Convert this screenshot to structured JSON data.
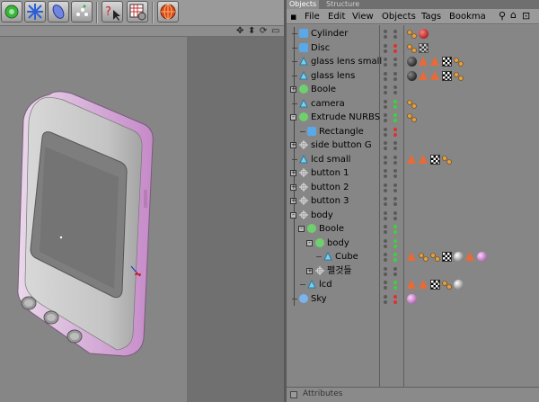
{
  "viewport": {
    "toolbar_icons": [
      "generator-icon",
      "deformer-icon",
      "spline-icon",
      "particle-icon",
      "help-pointer-icon",
      "render-settings-icon",
      "render-view-icon"
    ],
    "nav_icons": [
      "move-view-icon",
      "dolly-view-icon",
      "rotate-view-icon",
      "maximize-view-icon"
    ]
  },
  "om": {
    "tabs": [
      "Objects",
      "Structure"
    ],
    "menu": [
      "File",
      "Edit",
      "View",
      "Objects",
      "Tags",
      "Bookma"
    ],
    "rows": [
      {
        "name": "Cylinder",
        "depth": 0,
        "icon": "cylinder-icon",
        "exp": "",
        "dots": [
          "gray",
          "gray"
        ]
      },
      {
        "name": "Disc",
        "depth": 0,
        "icon": "disc-icon",
        "exp": "",
        "dots": [
          "gray",
          "red"
        ]
      },
      {
        "name": "glass lens small",
        "depth": 0,
        "icon": "cone-icon",
        "exp": "",
        "dots": [
          "gray",
          "gray"
        ]
      },
      {
        "name": "glass lens",
        "depth": 0,
        "icon": "cone-icon",
        "exp": "",
        "dots": [
          "gray",
          "gray"
        ]
      },
      {
        "name": "Boole",
        "depth": 0,
        "icon": "boole-icon",
        "exp": "+",
        "dots": [
          "gray",
          "gray"
        ]
      },
      {
        "name": "camera",
        "depth": 0,
        "icon": "cone-icon",
        "exp": "",
        "dots": [
          "gray",
          "green"
        ]
      },
      {
        "name": "Extrude NURBS",
        "depth": 0,
        "icon": "extrude-icon",
        "exp": "-",
        "dots": [
          "gray",
          "green"
        ]
      },
      {
        "name": "Rectangle",
        "depth": 1,
        "icon": "rectangle-icon",
        "exp": "",
        "dots": [
          "gray",
          "red"
        ]
      },
      {
        "name": "side button G",
        "depth": 0,
        "icon": "null-icon",
        "exp": "+",
        "dots": [
          "gray",
          "gray"
        ]
      },
      {
        "name": "lcd small",
        "depth": 0,
        "icon": "cone-icon",
        "exp": "",
        "dots": [
          "gray",
          "gray"
        ]
      },
      {
        "name": "button 1",
        "depth": 0,
        "icon": "null-icon",
        "exp": "+",
        "dots": [
          "gray",
          "gray"
        ]
      },
      {
        "name": "button 2",
        "depth": 0,
        "icon": "null-icon",
        "exp": "+",
        "dots": [
          "gray",
          "gray"
        ]
      },
      {
        "name": "button 3",
        "depth": 0,
        "icon": "null-icon",
        "exp": "+",
        "dots": [
          "gray",
          "gray"
        ]
      },
      {
        "name": "body",
        "depth": 0,
        "icon": "null-icon",
        "exp": "-",
        "dots": [
          "gray",
          "gray"
        ]
      },
      {
        "name": "Boole",
        "depth": 1,
        "icon": "boole-icon",
        "exp": "-",
        "dots": [
          "gray",
          "green"
        ]
      },
      {
        "name": "body",
        "depth": 2,
        "icon": "boole-icon",
        "exp": "-",
        "dots": [
          "gray",
          "green"
        ]
      },
      {
        "name": "Cube",
        "depth": 3,
        "icon": "cone-icon",
        "exp": "",
        "dots": [
          "gray",
          "green"
        ]
      },
      {
        "name": "펠것들",
        "depth": 2,
        "icon": "null-icon",
        "exp": "+",
        "dots": [
          "gray",
          "gray"
        ]
      },
      {
        "name": "lcd",
        "depth": 1,
        "icon": "cone-icon",
        "exp": "",
        "dots": [
          "gray",
          "green"
        ]
      },
      {
        "name": "Sky",
        "depth": 0,
        "icon": "sky-icon",
        "exp": "",
        "dots": [
          "gray",
          "red"
        ]
      }
    ],
    "attributes_label": "Attributes"
  },
  "colors": {
    "accent": "#e86a36",
    "green": "#3bd33b",
    "red": "#e03030"
  }
}
